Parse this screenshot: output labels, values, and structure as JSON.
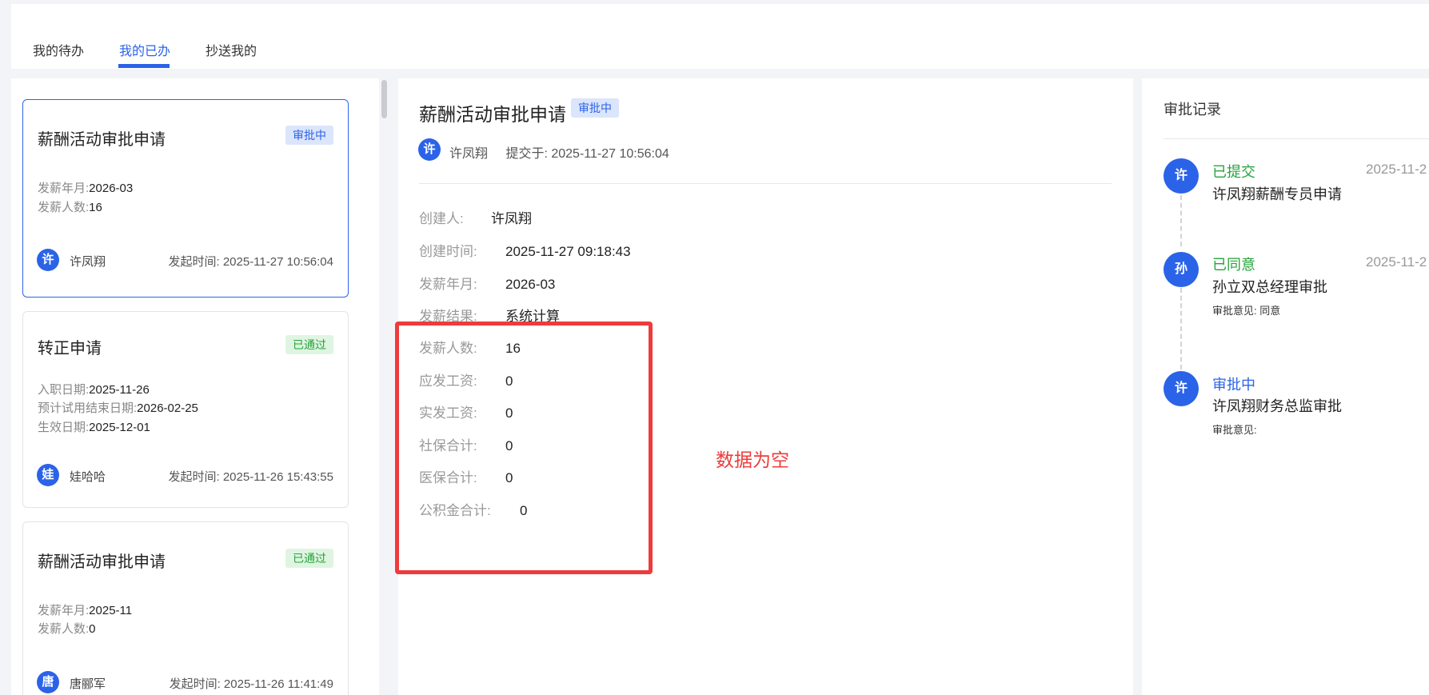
{
  "tabs": [
    {
      "label": "我的待办",
      "active": false
    },
    {
      "label": "我的已办",
      "active": true
    },
    {
      "label": "抄送我的",
      "active": false
    }
  ],
  "colors": {
    "accent": "#2b63e8",
    "success": "#27a33c",
    "annotation": "#ee3b3b"
  },
  "cards": [
    {
      "title": "薪酬活动审批申请",
      "status": "审批中",
      "fields": [
        {
          "label": "发薪年月:",
          "value": "2026-03"
        },
        {
          "label": "发薪人数:",
          "value": "16"
        }
      ],
      "avatar": "许",
      "user": "许凤翔",
      "time": "发起时间: 2025-11-27 10:56:04"
    },
    {
      "title": "转正申请",
      "status": "已通过",
      "fields": [
        {
          "label": "入职日期:",
          "value": "2025-11-26"
        },
        {
          "label": "预计试用结束日期:",
          "value": "2026-02-25"
        },
        {
          "label": "生效日期:",
          "value": "2025-12-01"
        }
      ],
      "avatar": "娃",
      "user": "娃哈哈",
      "time": "发起时间: 2025-11-26 15:43:55"
    },
    {
      "title": "薪酬活动审批申请",
      "status": "已通过",
      "fields": [
        {
          "label": "发薪年月:",
          "value": "2025-11"
        },
        {
          "label": "发薪人数:",
          "value": "0"
        }
      ],
      "avatar": "唐",
      "user": "唐郦军",
      "time": "发起时间: 2025-11-26 11:41:49"
    }
  ],
  "detail": {
    "title": "薪酬活动审批申请",
    "status": "审批中",
    "avatar": "许",
    "submitter": "许凤翔",
    "submitted": "提交于: 2025-11-27 10:56:04",
    "rows": [
      {
        "label": "创建人:",
        "value": "许凤翔"
      },
      {
        "label": "创建时间:",
        "value": "2025-11-27 09:18:43"
      },
      {
        "label": "发薪年月:",
        "value": "2026-03"
      },
      {
        "label": "发薪结果:",
        "value": "系统计算"
      },
      {
        "label": "发薪人数:",
        "value": "16"
      },
      {
        "label": "应发工资:",
        "value": "0"
      },
      {
        "label": "实发工资:",
        "value": "0"
      },
      {
        "label": "社保合计:",
        "value": "0"
      },
      {
        "label": "医保合计:",
        "value": "0"
      },
      {
        "label": "公积金合计:",
        "value": "0"
      }
    ],
    "annotation": "数据为空"
  },
  "records": {
    "title": "审批记录",
    "items": [
      {
        "avatar": "许",
        "status": "已提交",
        "status_type": "green",
        "time": "2025-11-2",
        "desc": "许凤翔薪酬专员申请",
        "note": ""
      },
      {
        "avatar": "孙",
        "status": "已同意",
        "status_type": "green",
        "time": "2025-11-2",
        "desc": "孙立双总经理审批",
        "note": "审批意见: 同意"
      },
      {
        "avatar": "许",
        "status": "审批中",
        "status_type": "blue",
        "time": "",
        "desc": "许凤翔财务总监审批",
        "note": "审批意见:"
      }
    ]
  }
}
